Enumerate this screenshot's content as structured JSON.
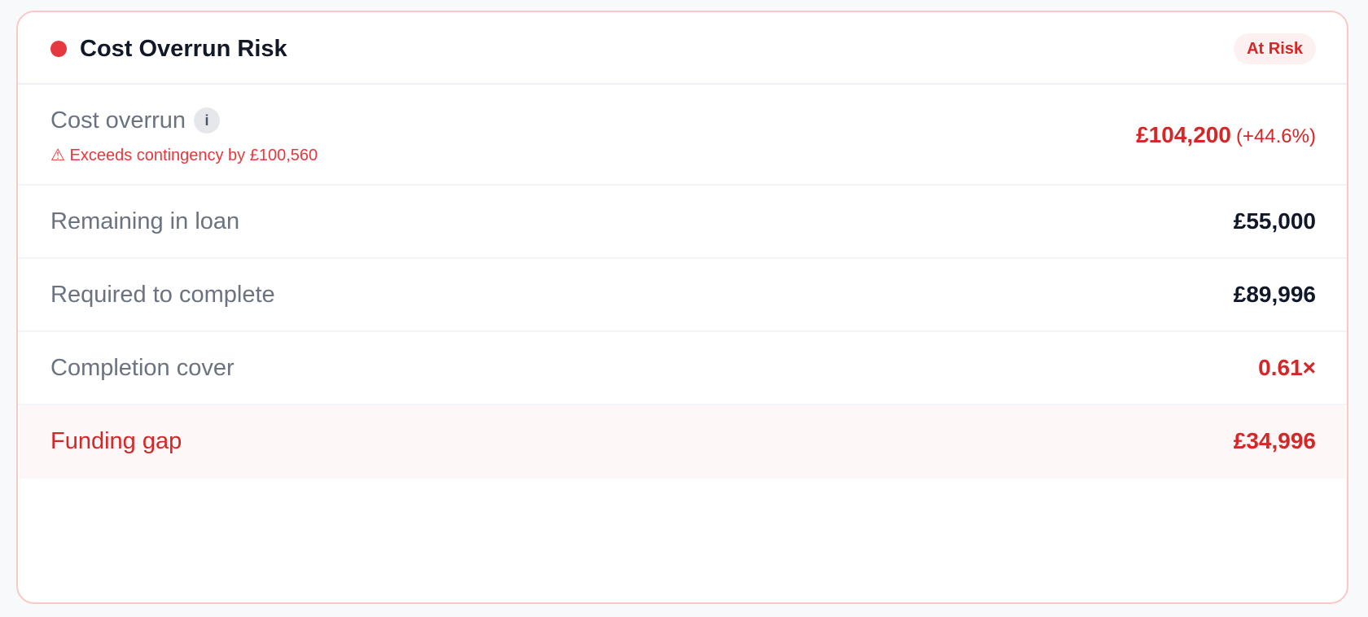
{
  "card": {
    "title": "Cost Overrun Risk",
    "status_badge": "At Risk",
    "accent_color": "#e5393f",
    "risk_color": "#d42727"
  },
  "rows": [
    {
      "label": "Cost overrun",
      "info_icon": "i",
      "warning_icon": "⚠",
      "warning": "Exceeds contingency by £100,560",
      "value": "£104,200",
      "change": "(+44.6%)"
    },
    {
      "label": "Remaining in loan",
      "value": "£55,000"
    },
    {
      "label": "Required to complete",
      "value": "£89,996"
    },
    {
      "label": "Completion cover",
      "value": "0.61×"
    },
    {
      "label": "Funding gap",
      "value": "£34,996"
    }
  ]
}
